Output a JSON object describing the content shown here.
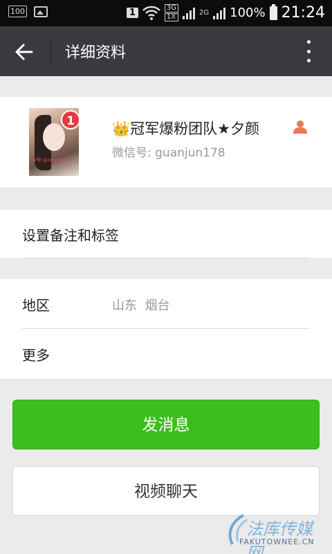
{
  "status_bar": {
    "notification_badge": "100",
    "sim_slot": "1",
    "net_3g": "3G",
    "net_1x": "1X",
    "net_2g": "2G",
    "battery": "100%",
    "time": "21:24"
  },
  "app_bar": {
    "title": "详细资料",
    "back_icon": "arrow-left-icon",
    "menu_icon": "more-vertical-icon"
  },
  "profile": {
    "name": "👑冠军爆粉团队★夕颜",
    "wechat_id": "微信号: guanjun178",
    "badge_count": "1",
    "avatar_caption": "V号:guanjun178"
  },
  "rows": {
    "remark": "设置备注和标签",
    "region_label": "地区",
    "region_value": "山东  烟台",
    "more_label": "更多"
  },
  "buttons": {
    "message": "发消息",
    "video_call": "视频聊天"
  },
  "watermark": {
    "text": "法库传媒网",
    "sub": "FAKUTOWNEE.CN"
  },
  "colors": {
    "app_bar": "#393a3f",
    "primary_button": "#3cbf1e",
    "badge": "#e43b44",
    "person_icon": "#f0774f"
  }
}
